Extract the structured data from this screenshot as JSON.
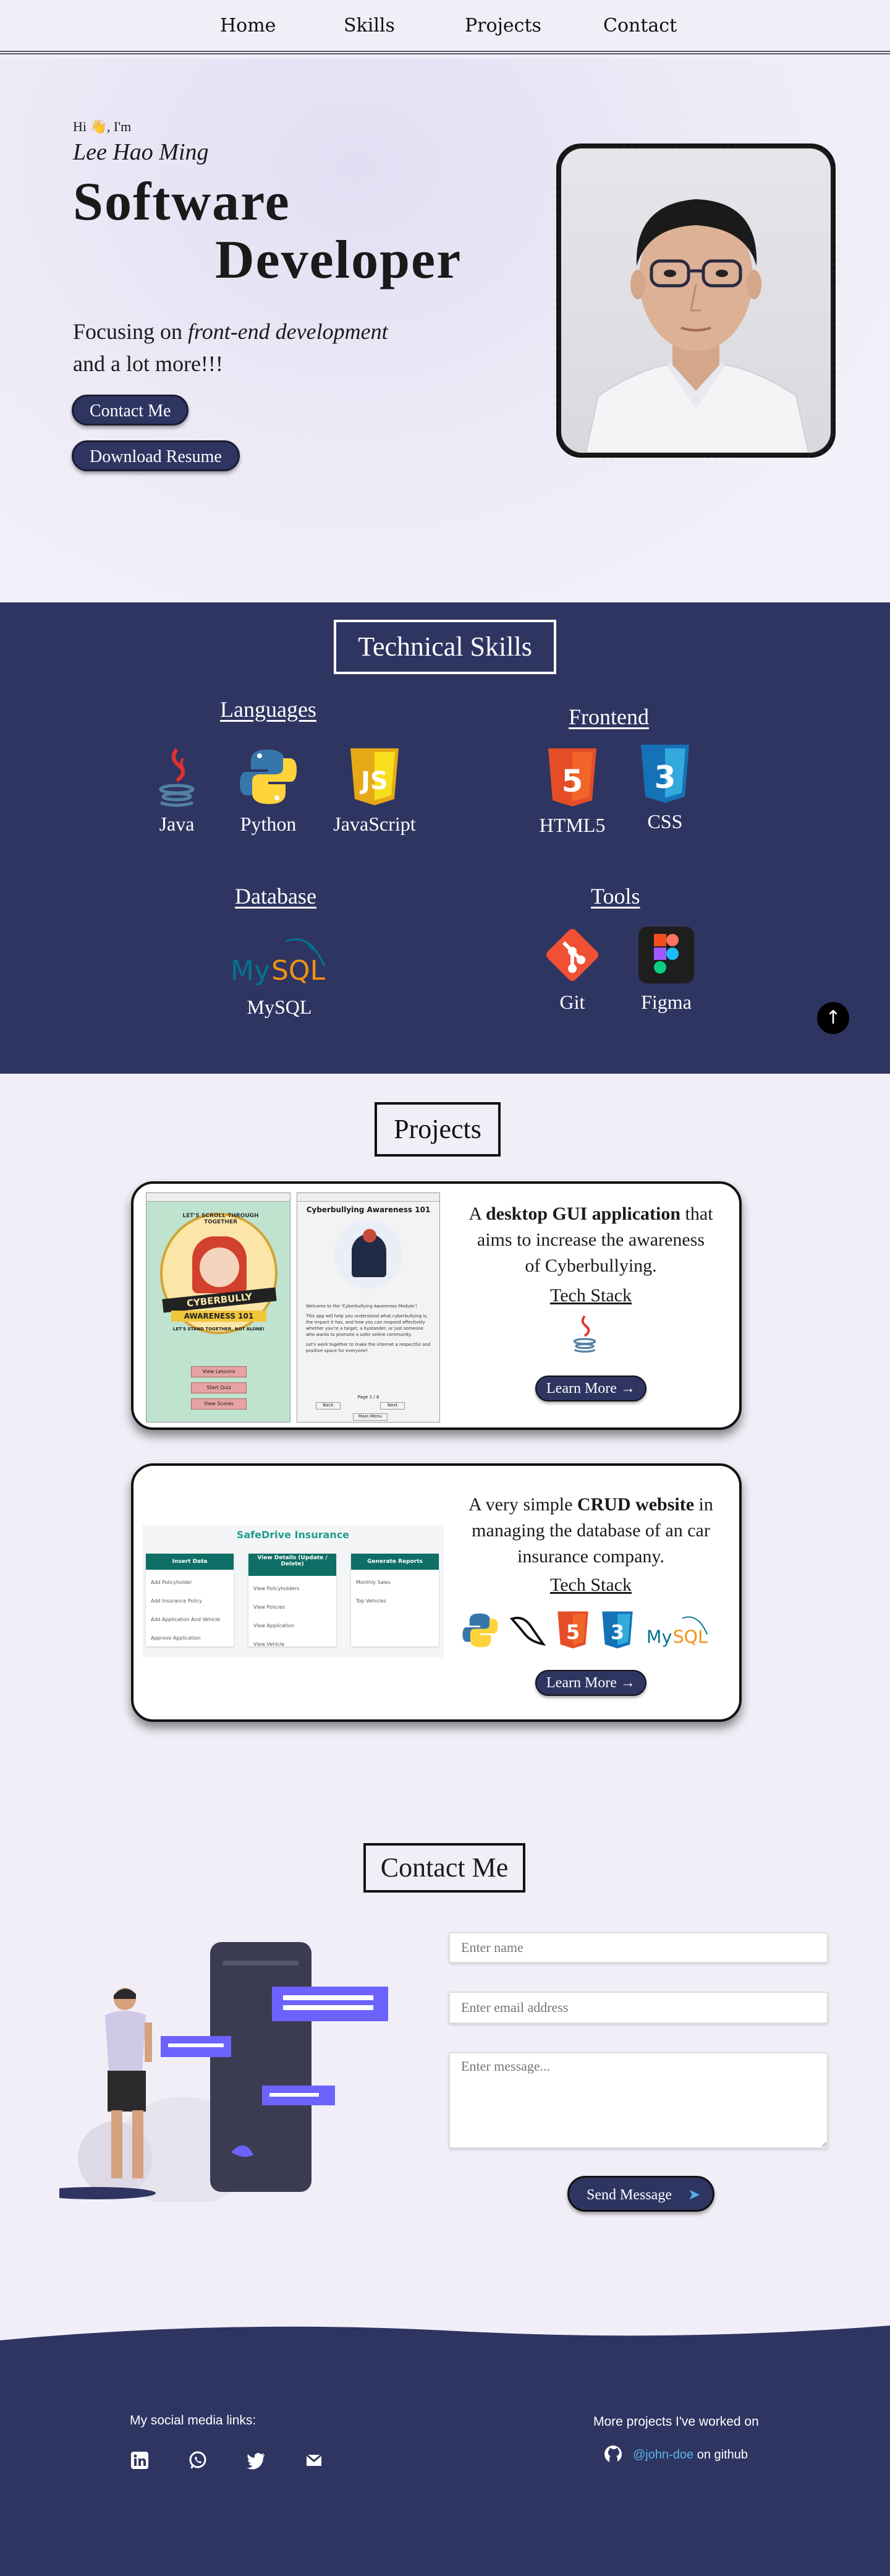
{
  "nav": {
    "home": "Home",
    "skills": "Skills",
    "projects": "Projects",
    "contact": "Contact"
  },
  "hero": {
    "greeting": "Hi 👋, I'm",
    "name": "Lee Hao Ming",
    "title_line1": "Software",
    "title_line2": "Developer",
    "focus_prefix": "Focusing on ",
    "focus_em": "front-end development",
    "focus_suffix": "and a lot more!!!",
    "contact_btn": "Contact Me",
    "resume_btn": "Download Resume"
  },
  "skills": {
    "title": "Technical Skills",
    "categories": {
      "languages": {
        "label": "Languages",
        "items": [
          "Java",
          "Python",
          "JavaScript"
        ]
      },
      "frontend": {
        "label": "Frontend",
        "items": [
          "HTML5",
          "CSS"
        ]
      },
      "database": {
        "label": "Database",
        "items": [
          "MySQL"
        ]
      },
      "tools": {
        "label": "Tools",
        "items": [
          "Git",
          "Figma"
        ]
      }
    },
    "scroll_top_icon": "arrow-up-icon"
  },
  "projects": {
    "title": "Projects",
    "items": [
      {
        "desc_prefix": "A ",
        "desc_bold": "desktop GUI application",
        "desc_suffix": " that aims to increase the awareness of Cyberbullying.",
        "tech_label": "Tech Stack",
        "tech": [
          "java-icon"
        ],
        "learn": "Learn More →",
        "shot": {
          "title": "Cyberbullying Awareness 101",
          "poster_top": "LET'S SCROLL THROUGH TOGETHER",
          "poster_main1": "CYBERBULLY",
          "poster_main2": "AWARENESS 101",
          "poster_sub": "LET'S STAND TOGETHER, NOT ALONE!",
          "btn1": "View Lessons",
          "btn2": "Start Quiz",
          "btn3": "View Scores",
          "welcome": "Welcome to the 'Cyberbullying Awareness Module'!",
          "body1": "This app will help you understand what cyberbullying is, the impact it has, and how you can respond effectively whether you're a target, a bystander, or just someone who wants to promote a safer online community.",
          "body2": "Let's work together to make the internet a respectful and positive space for everyone!",
          "page": "Page 1 / 6",
          "back": "Back",
          "next": "Next",
          "main_menu": "Main Menu"
        }
      },
      {
        "desc_prefix": "A very simple ",
        "desc_bold": "CRUD website",
        "desc_suffix": " in managing the database of an car insurance company.",
        "tech_label": "Tech Stack",
        "tech": [
          "python-icon",
          "flask-icon",
          "html5-icon",
          "css3-icon",
          "mysql-icon"
        ],
        "learn": "Learn More →",
        "shot": {
          "title": "SafeDrive Insurance",
          "columns": [
            {
              "head": "Insert Data",
              "rows": [
                "Add Policyholder",
                "Add Insurance Policy",
                "Add Application And Vehicle",
                "Approve Application"
              ]
            },
            {
              "head": "View Details (Update / Delete)",
              "rows": [
                "View Policyholders",
                "View Policies",
                "View Application",
                "View Vehicle"
              ]
            },
            {
              "head": "Generate Reports",
              "rows": [
                "Monthly Sales",
                "Top Vehicles"
              ]
            }
          ]
        }
      }
    ]
  },
  "contact": {
    "title": "Contact Me",
    "name_placeholder": "Enter name",
    "email_placeholder": "Enter email address",
    "message_placeholder": "Enter message...",
    "send": "Send Message"
  },
  "footer": {
    "social_label": "My social media links:",
    "social_icons": [
      "linkedin-icon",
      "whatsapp-icon",
      "twitter-icon",
      "email-icon"
    ],
    "projects_label": "More projects I've worked on",
    "github_user": "@john-doe",
    "github_suffix": " on github"
  },
  "colors": {
    "navy": "#2f3561",
    "bg": "#f2eef8",
    "accent_purple": "#6c63ff"
  }
}
